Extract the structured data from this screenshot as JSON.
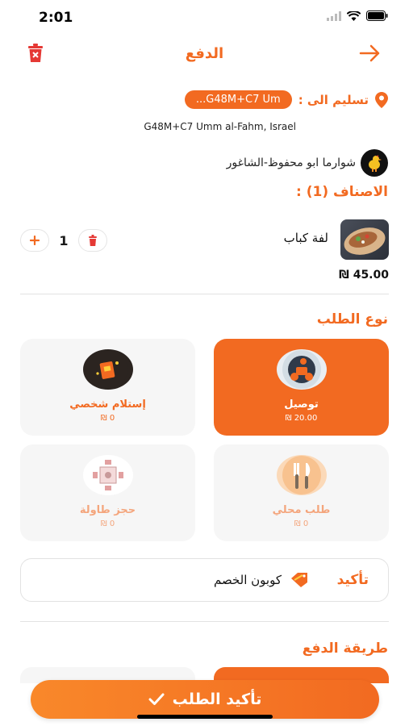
{
  "status_bar": {
    "time": "2:01"
  },
  "header": {
    "title": "الدفع"
  },
  "delivery": {
    "label": "تسليم الى :",
    "address_short": "...G48M+C7 Um",
    "address_full": "G48M+C7 Umm al-Fahm, Israel"
  },
  "restaurant": {
    "name": "شوارما ابو محفوظ-الشاغور"
  },
  "items": {
    "title": "الاصناف (1) :",
    "list": [
      {
        "name": "لفة كباب",
        "quantity": "1",
        "price": "45.00 ₪"
      }
    ]
  },
  "order_type": {
    "title": "نوع الطلب",
    "options": [
      {
        "label": "توصيل",
        "price": "20.00 ₪",
        "selected": true,
        "icon": "delivery-scooter-icon"
      },
      {
        "label": "إستلام شخصي",
        "price": "0 ₪",
        "selected": false,
        "icon": "pickup-bag-icon"
      },
      {
        "label": "طلب محلي",
        "price": "0 ₪",
        "selected": false,
        "icon": "fork-knife-icon"
      },
      {
        "label": "حجز طاولة",
        "price": "0 ₪",
        "selected": false,
        "icon": "table-booking-icon"
      }
    ]
  },
  "coupon": {
    "label": "كوبون الخصم",
    "confirm_label": "تأكيد"
  },
  "payment": {
    "title": "طريقة الدفع"
  },
  "confirm_button": {
    "label": "تأكيد الطلب"
  },
  "colors": {
    "accent": "#f26a21",
    "card_bg": "#f6f6f6"
  }
}
